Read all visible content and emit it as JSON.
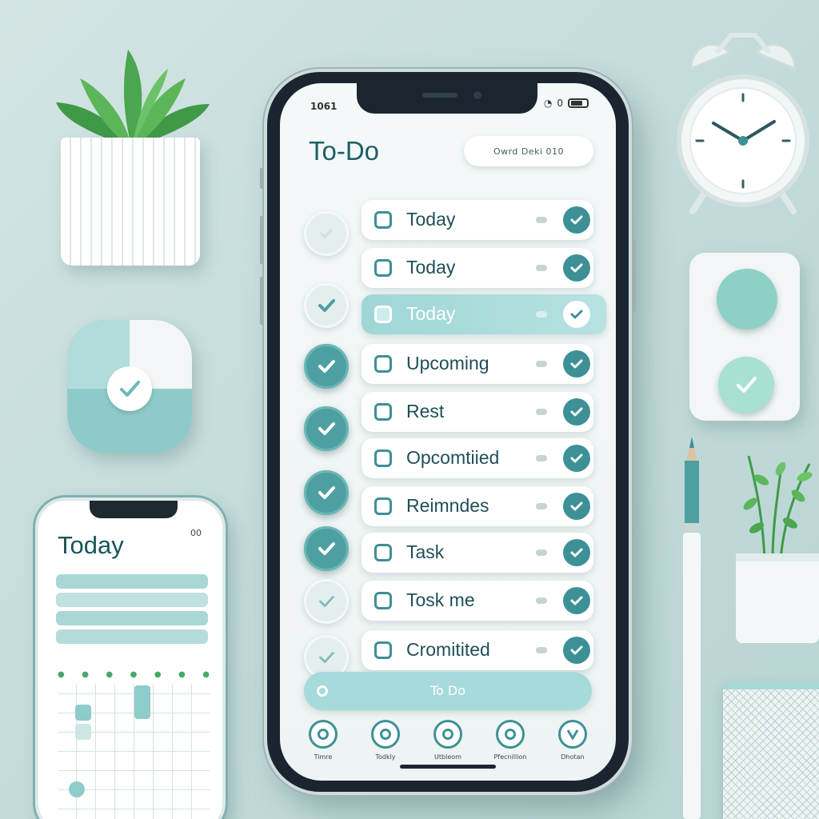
{
  "main_phone": {
    "status_time": "1061",
    "status_right": "0",
    "app_title": "To-Do",
    "search_pill": "Owrd    Deki 010",
    "tasks": [
      {
        "label": "Today",
        "left_circle": "light",
        "active": false
      },
      {
        "label": "Today",
        "left_circle": "none",
        "active": false
      },
      {
        "label": "Today",
        "left_circle": "light",
        "active": true
      },
      {
        "label": "Upcoming",
        "left_circle": "dark",
        "active": false
      },
      {
        "label": "Rest",
        "left_circle": "dark",
        "active": false
      },
      {
        "label": "Opcomtiied",
        "left_circle": "dark",
        "active": false
      },
      {
        "label": "Reimndes",
        "left_circle": "dark",
        "active": false
      },
      {
        "label": "Task",
        "left_circle": "dark",
        "active": false
      },
      {
        "label": "Tosk me",
        "left_circle": "light",
        "active": false
      },
      {
        "label": "Cromitited",
        "left_circle": "light",
        "active": false
      }
    ],
    "todo_button": "To Do",
    "tabs": [
      {
        "label": "Timre"
      },
      {
        "label": "Todkly"
      },
      {
        "label": "Utbleom"
      },
      {
        "label": "Pfecnillion"
      },
      {
        "label": "Dhotan"
      }
    ]
  },
  "small_phone": {
    "title": "Today",
    "status": "00"
  },
  "colors": {
    "accent": "#3d9196",
    "accent_light": "#a6dadb",
    "title": "#1d5f68",
    "background": "#c4dcdb"
  },
  "icons": [
    "checkbox-icon",
    "checkmark-icon",
    "clock-icon",
    "plant-icon",
    "pencil-icon"
  ]
}
